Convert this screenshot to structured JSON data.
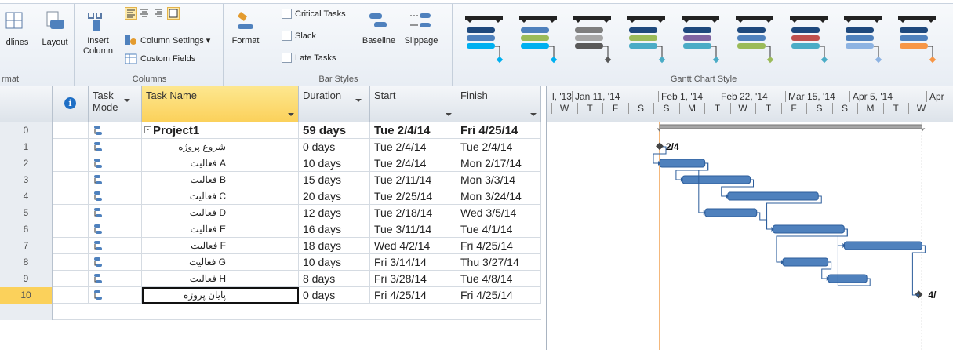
{
  "ribbon": {
    "format_group": {
      "gridlines_label": "dlines",
      "layout_label": "Layout",
      "group_label": "rmat"
    },
    "columns_group": {
      "insert_column_label": "Insert Column",
      "column_settings_label": "Column Settings ▾",
      "custom_fields_label": "Custom Fields",
      "group_label": "Columns"
    },
    "bar_styles_group": {
      "format_label": "Format",
      "critical_tasks_label": "Critical Tasks",
      "slack_label": "Slack",
      "late_tasks_label": "Late Tasks",
      "baseline_label": "Baseline",
      "slippage_label": "Slippage",
      "group_label": "Bar Styles"
    },
    "gantt_style_group": {
      "group_label": "Gantt Chart Style",
      "styles": [
        {
          "top": "#1f497d",
          "mid": "#4f81bd",
          "low": "#00b0f0"
        },
        {
          "top": "#4f81bd",
          "mid": "#9bbb59",
          "low": "#00b0f0"
        },
        {
          "top": "#7f7f7f",
          "mid": "#a6a6a6",
          "low": "#595959"
        },
        {
          "top": "#1f497d",
          "mid": "#9bbb59",
          "low": "#4bacc6"
        },
        {
          "top": "#1f497d",
          "mid": "#8064a2",
          "low": "#4bacc6"
        },
        {
          "top": "#1f497d",
          "mid": "#4f81bd",
          "low": "#9bbb59"
        },
        {
          "top": "#1f497d",
          "mid": "#c0504d",
          "low": "#4bacc6"
        },
        {
          "top": "#1f497d",
          "mid": "#4f81bd",
          "low": "#8db3e2"
        },
        {
          "top": "#1f497d",
          "mid": "#4f81bd",
          "low": "#f79646"
        }
      ]
    }
  },
  "table": {
    "headers": {
      "info": "i",
      "task_mode": "Task Mode",
      "task_name": "Task Name",
      "duration": "Duration",
      "start": "Start",
      "finish": "Finish"
    },
    "rows": [
      {
        "id": "0",
        "name": "Project1",
        "duration": "59 days",
        "start": "Tue 2/4/14",
        "finish": "Fri 4/25/14",
        "summary": true
      },
      {
        "id": "1",
        "name": "شروع پروژه",
        "duration": "0 days",
        "start": "Tue 2/4/14",
        "finish": "Tue 2/4/14"
      },
      {
        "id": "2",
        "name": "فعالیت A",
        "duration": "10 days",
        "start": "Tue 2/4/14",
        "finish": "Mon 2/17/14"
      },
      {
        "id": "3",
        "name": "فعالیت B",
        "duration": "15 days",
        "start": "Tue 2/11/14",
        "finish": "Mon 3/3/14"
      },
      {
        "id": "4",
        "name": "فعالیت C",
        "duration": "20 days",
        "start": "Tue 2/25/14",
        "finish": "Mon 3/24/14"
      },
      {
        "id": "5",
        "name": "فعالیت D",
        "duration": "12 days",
        "start": "Tue 2/18/14",
        "finish": "Wed 3/5/14"
      },
      {
        "id": "6",
        "name": "فعالیت E",
        "duration": "16 days",
        "start": "Tue 3/11/14",
        "finish": "Tue 4/1/14"
      },
      {
        "id": "7",
        "name": "فعالیت F",
        "duration": "18 days",
        "start": "Wed 4/2/14",
        "finish": "Fri 4/25/14"
      },
      {
        "id": "8",
        "name": "فعالیت G",
        "duration": "10 days",
        "start": "Fri 3/14/14",
        "finish": "Thu 3/27/14"
      },
      {
        "id": "9",
        "name": "فعالیت H",
        "duration": "8 days",
        "start": "Fri 3/28/14",
        "finish": "Tue 4/8/14"
      },
      {
        "id": "10",
        "name": "پایان پروژه",
        "duration": "0 days",
        "start": "Fri 4/25/14",
        "finish": "Fri 4/25/14",
        "selected": true
      }
    ]
  },
  "timescale": {
    "major": [
      "l, '13",
      "Jan 11, '14",
      "Feb 1, '14",
      "Feb 22, '14",
      "Mar 15, '14",
      "Apr 5, '14",
      "Apr"
    ],
    "minor": [
      "W",
      "T",
      "F",
      "S",
      "S",
      "M",
      "T",
      "W",
      "T",
      "F",
      "S",
      "S",
      "M",
      "T",
      "W"
    ]
  },
  "gantt": {
    "milestone_start_label": "2/4",
    "milestone_end_label": "4/",
    "bar_color": "#4f81bd"
  }
}
